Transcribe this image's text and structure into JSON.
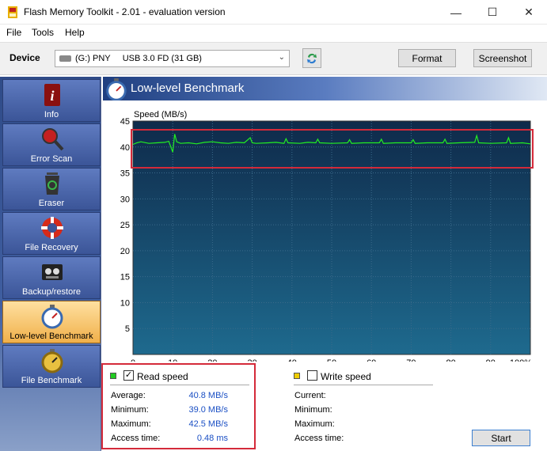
{
  "window": {
    "title": "Flash Memory Toolkit - 2.01 - evaluation version"
  },
  "menu": [
    "File",
    "Tools",
    "Help"
  ],
  "devicebar": {
    "label": "Device",
    "selected_device": "(G:) PNY     USB 3.0 FD (31 GB)",
    "format_label": "Format",
    "screenshot_label": "Screenshot"
  },
  "sidebar": {
    "items": [
      {
        "label": "Info",
        "icon": "info-icon"
      },
      {
        "label": "Error Scan",
        "icon": "magnifier-icon"
      },
      {
        "label": "Eraser",
        "icon": "recycle-bin-icon"
      },
      {
        "label": "File Recovery",
        "icon": "lifebuoy-icon"
      },
      {
        "label": "Backup/restore",
        "icon": "tape-icon"
      },
      {
        "label": "Low-level Benchmark",
        "icon": "stopwatch-icon"
      },
      {
        "label": "File Benchmark",
        "icon": "stopwatch-gold-icon"
      }
    ],
    "active_index": 5
  },
  "panel": {
    "title": "Low-level Benchmark"
  },
  "chart_data": {
    "type": "line",
    "ylabel": "Speed (MB/s)",
    "xlabel": "",
    "ylim": [
      0,
      45
    ],
    "xlim": [
      0,
      100
    ],
    "y_ticks": [
      "45",
      "40",
      "35",
      "30",
      "25",
      "20",
      "15",
      "10",
      "5"
    ],
    "x_ticks": [
      "0",
      "10",
      "20",
      "30",
      "40",
      "50",
      "60",
      "70",
      "80",
      "90",
      "100%"
    ],
    "series": [
      {
        "name": "Read speed",
        "color": "#22ee22",
        "x": [
          0,
          1,
          2,
          4,
          6,
          8,
          9,
          10,
          10.5,
          11,
          12,
          14,
          16,
          18,
          20,
          22,
          24,
          26,
          28,
          29.5,
          30,
          31,
          34,
          36,
          38,
          38.5,
          39,
          42,
          44,
          46,
          46.5,
          47,
          50,
          54,
          54.5,
          55,
          58,
          62,
          62.5,
          63,
          66,
          70,
          70.5,
          71,
          74,
          78,
          78.5,
          79,
          82,
          86,
          86.5,
          87,
          90,
          94,
          94.5,
          95,
          98,
          100
        ],
        "y": [
          40.5,
          40.8,
          41.0,
          40.7,
          40.8,
          40.9,
          41.1,
          39.0,
          42.5,
          41.0,
          40.7,
          40.8,
          40.6,
          40.9,
          41.0,
          40.8,
          40.7,
          40.9,
          40.8,
          41.8,
          40.8,
          40.7,
          40.8,
          40.9,
          40.7,
          41.6,
          40.8,
          40.7,
          40.9,
          40.8,
          41.5,
          40.8,
          40.7,
          40.8,
          41.4,
          40.7,
          40.8,
          40.8,
          41.5,
          40.7,
          40.8,
          40.8,
          41.4,
          40.7,
          40.8,
          40.8,
          41.5,
          40.7,
          40.8,
          40.9,
          42.2,
          40.8,
          40.7,
          40.8,
          41.8,
          40.7,
          40.8,
          40.6
        ]
      }
    ],
    "grid": true
  },
  "stats": {
    "read": {
      "label": "Read speed",
      "checked": true,
      "color": "#22cc22",
      "rows": [
        {
          "label": "Average:",
          "value": "40.8 MB/s"
        },
        {
          "label": "Minimum:",
          "value": "39.0 MB/s"
        },
        {
          "label": "Maximum:",
          "value": "42.5 MB/s"
        },
        {
          "label": "Access time:",
          "value": "0.48 ms"
        }
      ]
    },
    "write": {
      "label": "Write speed",
      "checked": false,
      "color": "#eecc00",
      "rows": [
        {
          "label": "Current:",
          "value": ""
        },
        {
          "label": "Minimum:",
          "value": ""
        },
        {
          "label": "Maximum:",
          "value": ""
        },
        {
          "label": "Access time:",
          "value": ""
        }
      ]
    },
    "start_label": "Start"
  },
  "colors": {
    "highlight": "#d42a3a",
    "chart_bg_top": "#0f2a4a",
    "chart_bg_bottom": "#1e6a8e",
    "value_text": "#1a4fc4"
  }
}
